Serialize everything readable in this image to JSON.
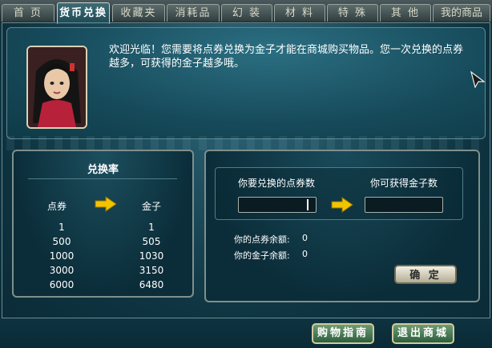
{
  "tabs": [
    {
      "label": "首 页",
      "active": false
    },
    {
      "label": "货币兑换",
      "active": true
    },
    {
      "label": "收藏夹",
      "active": false
    },
    {
      "label": "消耗品",
      "active": false
    },
    {
      "label": "幻 装",
      "active": false
    },
    {
      "label": "材 料",
      "active": false
    },
    {
      "label": "特 殊",
      "active": false
    },
    {
      "label": "其 他",
      "active": false
    },
    {
      "label": "我的商品",
      "active": false
    }
  ],
  "welcome_text": "欢迎光临！您需要将点券兑换为金子才能在商城购买物品。您一次兑换的点券越多，可获得的金子越多哦。",
  "rate": {
    "title": "兑换率",
    "col_left": "点券",
    "col_right": "金子",
    "rows": [
      {
        "left": "1",
        "right": "1"
      },
      {
        "left": "500",
        "right": "505"
      },
      {
        "left": "1000",
        "right": "1030"
      },
      {
        "left": "3000",
        "right": "3150"
      },
      {
        "left": "6000",
        "right": "6480"
      }
    ]
  },
  "exchange": {
    "input_label": "你要兑换的点券数",
    "output_label": "你可获得金子数",
    "input_value": "",
    "output_value": "",
    "coupon_balance_label": "你的点券余额:",
    "coupon_balance": "0",
    "gold_balance_label": "你的金子余额:",
    "gold_balance": "0",
    "confirm_label": "确 定"
  },
  "footer": {
    "guide_label": "购物指南",
    "exit_label": "退出商城"
  },
  "colors": {
    "arrow": "#f2c400",
    "panel_border": "#7f8f8c",
    "accent_green": "#2d5e3d"
  }
}
